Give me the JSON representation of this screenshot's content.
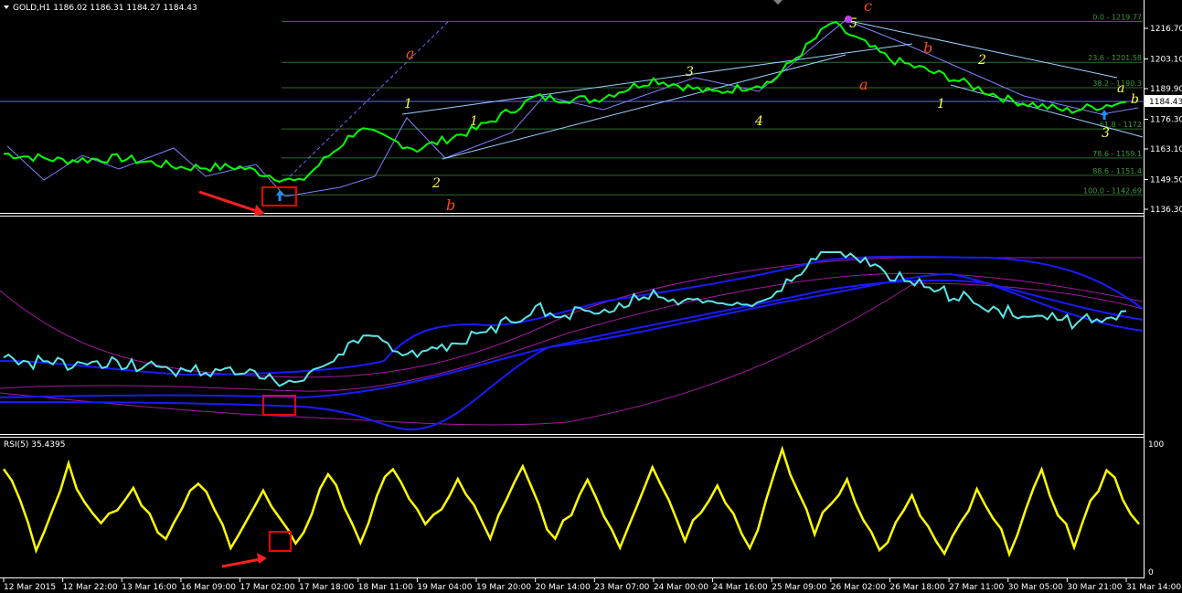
{
  "main": {
    "header": "GOLD,H1  1186.02 1186.31 1184.27 1184.43",
    "price_labels": [
      "1216.70",
      "1203.10",
      "1189.90",
      "1176.30",
      "1163.10",
      "1149.50",
      "1136.30"
    ],
    "current_price": "1184.43",
    "fib_levels": [
      {
        "label": "0.0 - 1219.77",
        "price": 1219.77
      },
      {
        "label": "23.6 - 1201.58",
        "price": 1201.58
      },
      {
        "label": "38.2 - 1190.3",
        "price": 1190.3
      },
      {
        "label": "61.8 - 1172",
        "price": 1172.0
      },
      {
        "label": "78.6 - 1159.1",
        "price": 1159.1
      },
      {
        "label": "88.6 - 1151.4",
        "price": 1151.4
      },
      {
        "label": "100.0 - 1142.69",
        "price": 1142.69
      }
    ],
    "wave_labels_yellow": [
      "1",
      "1",
      "2",
      "3",
      "4",
      "5",
      "1",
      "2",
      "3",
      "a",
      "b"
    ],
    "wave_labels_red": [
      "a",
      "b",
      "a",
      "c",
      "b"
    ]
  },
  "rsi": {
    "header": "RSI(5) 35.4395",
    "scale_labels": [
      "100",
      "0"
    ]
  },
  "time_axis": [
    "12 Mar 2015",
    "12 Mar 22:00",
    "13 Mar 16:00",
    "16 Mar 09:00",
    "17 Mar 02:00",
    "17 Mar 18:00",
    "18 Mar 11:00",
    "19 Mar 04:00",
    "19 Mar 20:00",
    "20 Mar 14:00",
    "23 Mar 07:00",
    "24 Mar 00:00",
    "24 Mar 16:00",
    "25 Mar 09:00",
    "26 Mar 02:00",
    "26 Mar 18:00",
    "27 Mar 11:00",
    "30 Mar 05:00",
    "30 Mar 21:00",
    "31 Mar 14:00"
  ],
  "colors": {
    "background": "#000000",
    "candles": "#00ff00",
    "fib": "#3c9a3c",
    "wave_yellow": "#ffff46",
    "wave_red": "#ff4a1a",
    "rsi": "#ffff00",
    "bands_blue": "#1a1aff",
    "bands_magenta": "#a01aa0",
    "oscillator": "#5ae6e6",
    "highlight": "#ff0000"
  },
  "chart_data": [
    {
      "type": "candlestick",
      "title": "GOLD,H1",
      "y_range": [
        1136.3,
        1222
      ],
      "path_keypoints": {
        "x": [
          "12 Mar 2015",
          "12 Mar 22:00",
          "13 Mar 16:00",
          "16 Mar 09:00",
          "17 Mar 02:00",
          "17 Mar 18:00",
          "18 Mar 11:00",
          "19 Mar 04:00",
          "19 Mar 20:00",
          "20 Mar 14:00",
          "23 Mar 07:00",
          "24 Mar 00:00",
          "24 Mar 16:00",
          "25 Mar 09:00",
          "26 Mar 02:00",
          "26 Mar 18:00",
          "27 Mar 11:00",
          "30 Mar 05:00",
          "30 Mar 21:00",
          "31 Mar 14:00"
        ],
        "y": [
          1161,
          1158,
          1159,
          1155,
          1155,
          1148,
          1172,
          1163,
          1172,
          1186,
          1185,
          1194,
          1188,
          1193,
          1219,
          1203,
          1195,
          1185,
          1180,
          1184
        ]
      }
    },
    {
      "type": "line",
      "title": "RSI(5) 35.4395",
      "ylim": [
        0,
        100
      ],
      "series": [
        {
          "name": "RSI(5)",
          "values": [
            85,
            18,
            80,
            35,
            65,
            22,
            70,
            20,
            60,
            15,
            78,
            22,
            85,
            30,
            70,
            25,
            80,
            20,
            72,
            18,
            85,
            25,
            70,
            15,
            92,
            30,
            72,
            12,
            55,
            8,
            60,
            15,
            75,
            18,
            82,
            35
          ]
        }
      ]
    }
  ]
}
